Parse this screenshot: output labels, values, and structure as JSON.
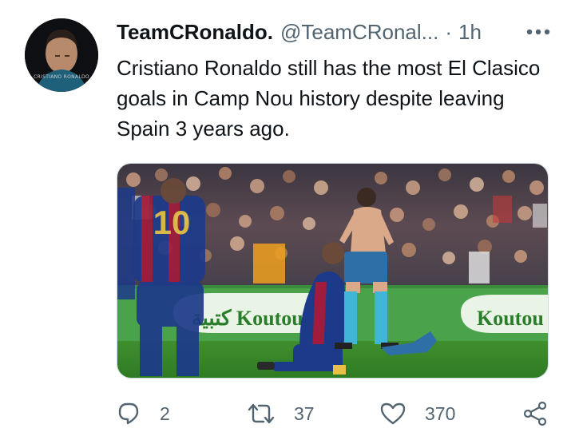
{
  "tweet": {
    "display_name": "TeamCRonaldo.",
    "handle": "@TeamCRonal...",
    "separator": "·",
    "time": "1h",
    "text": "Cristiano Ronaldo still has the most El Clasico goals in Camp Nou history despite leaving Spain 3 years ago.",
    "avatar_caption": "CRISTIANO RONALDO",
    "media": {
      "boards": [
        "كتبية Koutoubia",
        "Koutou"
      ],
      "back_number": "10",
      "colors": {
        "pitch": "#3f8f2e",
        "board": "#4aa24a",
        "barca_blue": "#1d3a8a",
        "barca_red": "#a01c3c",
        "shorts": "#2f6fa8",
        "socks": "#3fb6d8"
      }
    }
  },
  "actions": {
    "reply": {
      "icon": "reply-icon",
      "count": "2"
    },
    "retweet": {
      "icon": "retweet-icon",
      "count": "37"
    },
    "like": {
      "icon": "heart-icon",
      "count": "370"
    },
    "share": {
      "icon": "share-icon"
    }
  },
  "colors": {
    "text": "#0f1419",
    "secondary": "#536471",
    "border": "#cfd9de"
  }
}
